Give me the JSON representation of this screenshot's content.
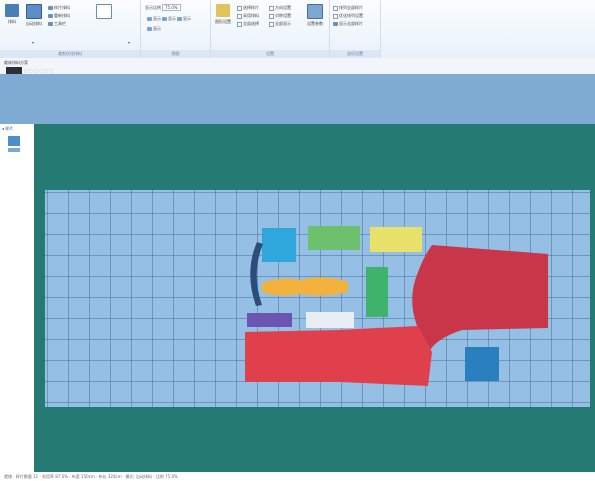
{
  "ribbon": {
    "groups": [
      {
        "caption": "裁剪优化排料",
        "buttons": [
          {
            "label": "排料",
            "icon": "layout-icon"
          },
          {
            "label": "自动排料",
            "icon": "auto-nest-icon"
          }
        ],
        "small_items": [
          "样片排料",
          "重新排料",
          "工具栏"
        ]
      },
      {
        "caption": "视图",
        "buttons": [
          {
            "label": "查看",
            "icon": "view-icon"
          }
        ],
        "small_items": [
          "显示比例",
          "显示",
          "显示",
          "显示",
          "显示"
        ],
        "zoom_value": "75.0%"
      },
      {
        "caption": "设置",
        "buttons": [
          {
            "label": "图形设置",
            "icon": "shape-settings-icon"
          },
          {
            "label": "设置参数",
            "icon": "params-icon"
          }
        ],
        "small_items": [
          "选择样片",
          "采用排料",
          "全部选择",
          "方向设置",
          "对称设置",
          "全部显示"
        ]
      },
      {
        "caption": "选项设置",
        "buttons": [],
        "small_items": [
          "排列全部样片",
          "优化排列设置",
          "显示全部样片"
        ]
      }
    ]
  },
  "document": {
    "title": "裁床排料方案",
    "tab_strip": "▢ ▢ ▢ ▢ ▢ ▢"
  },
  "left_panel": {
    "header": "◂ 样片"
  },
  "pieces": [
    {
      "name": "cyan-square",
      "color": "#2fa6dc"
    },
    {
      "name": "green-rect",
      "color": "#6cc06e"
    },
    {
      "name": "yellow-rect",
      "color": "#e8e26a"
    },
    {
      "name": "red-sleeve",
      "color": "#c9364a"
    },
    {
      "name": "navy-curve",
      "color": "#2a4d7a"
    },
    {
      "name": "orange-band",
      "color": "#f2b23c"
    },
    {
      "name": "green-tall",
      "color": "#3fb36b"
    },
    {
      "name": "purple-strip",
      "color": "#6a55b0"
    },
    {
      "name": "white-strip",
      "color": "#e8eef4"
    },
    {
      "name": "red-panel",
      "color": "#e0404c"
    },
    {
      "name": "blue-square",
      "color": "#2a7fbf"
    }
  ],
  "colors": {
    "fabric": "#257a74",
    "grid": "#96bfe5",
    "band": "#7fabd3"
  },
  "status": {
    "text": "就绪 · 样片数量 11 · 利用率 87.5% · 布宽 150cm · 布长 320cm · 模式: 自动排料 · 比例 75.0%"
  }
}
